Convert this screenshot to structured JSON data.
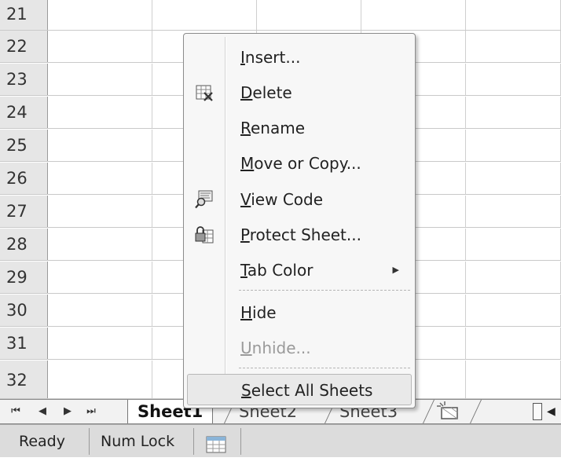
{
  "rows": [
    "21",
    "22",
    "23",
    "24",
    "25",
    "26",
    "27",
    "28",
    "29",
    "30",
    "31",
    "32"
  ],
  "context_menu": {
    "items": [
      {
        "id": "insert",
        "pre": "",
        "u": "I",
        "post": "nsert...",
        "icon": "",
        "disabled": false
      },
      {
        "id": "delete",
        "pre": "",
        "u": "D",
        "post": "elete",
        "icon": "delete-sheet-icon",
        "disabled": false
      },
      {
        "id": "rename",
        "pre": "",
        "u": "R",
        "post": "ename",
        "icon": "",
        "disabled": false
      },
      {
        "id": "move-copy",
        "pre": "",
        "u": "M",
        "post": "ove or Copy...",
        "icon": "",
        "disabled": false
      },
      {
        "id": "view-code",
        "pre": "",
        "u": "V",
        "post": "iew Code",
        "icon": "view-code-icon",
        "disabled": false
      },
      {
        "id": "protect-sheet",
        "pre": "",
        "u": "P",
        "post": "rotect Sheet...",
        "icon": "protect-sheet-icon",
        "disabled": false
      },
      {
        "id": "tab-color",
        "pre": "",
        "u": "T",
        "post": "ab Color",
        "icon": "",
        "disabled": false,
        "submenu": true
      },
      {
        "id": "hide",
        "pre": "",
        "u": "H",
        "post": "ide",
        "icon": "",
        "disabled": false
      },
      {
        "id": "unhide",
        "pre": "",
        "u": "U",
        "post": "nhide...",
        "icon": "",
        "disabled": true
      },
      {
        "id": "select-all-sheets",
        "pre": "",
        "u": "S",
        "post": "elect All Sheets",
        "icon": "",
        "disabled": false,
        "highlighted": true
      }
    ]
  },
  "sheet_tabs": [
    "Sheet1",
    "Sheet2",
    "Sheet3"
  ],
  "status_bar": {
    "ready": "Ready",
    "num_lock": "Num Lock"
  },
  "nav_buttons": {
    "first": "⏮",
    "prev": "◀",
    "next": "▶",
    "last": "⏭"
  }
}
